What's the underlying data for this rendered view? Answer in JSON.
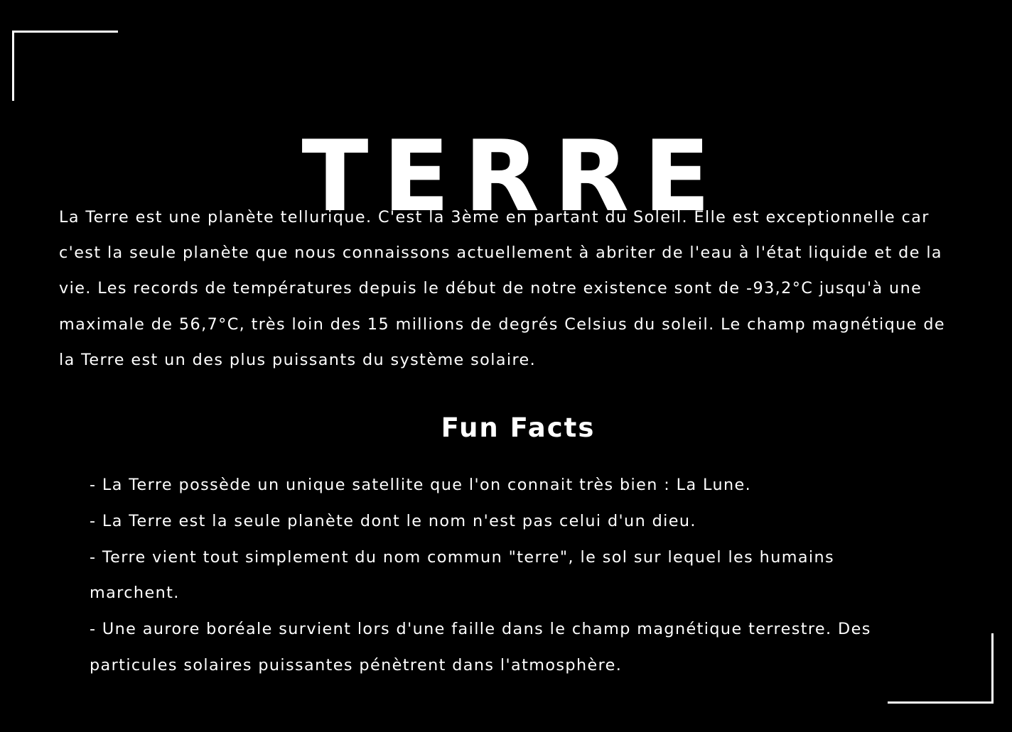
{
  "title": "TERRE",
  "intro": "La Terre est une planète tellurique. C'est la 3ème en partant du Soleil. Elle est exceptionnelle car c'est la seule planète que nous connaissons actuellement à abriter de l'eau à l'état liquide et de la vie. Les records de températures depuis le début de notre existence sont de -93,2°C jusqu'à une maximale de 56,7°C, très loin des 15 millions de degrés Celsius du soleil. Le champ magnétique de la Terre est un des plus puissants du système solaire.",
  "fun_facts": {
    "heading": "Fun Facts",
    "items": [
      "- La Terre possède un unique satellite que l'on connait très bien : La Lune.",
      "- La Terre est la seule planète dont le nom n'est pas celui d'un dieu.",
      "- Terre vient tout simplement du nom commun \"terre\", le sol sur lequel les humains marchent.",
      "- Une aurore boréale survient lors d'une faille dans le champ magnétique terrestre. Des particules solaires puissantes pénètrent dans l'atmosphère."
    ]
  },
  "colors": {
    "background": "#000000",
    "text": "#ffffff"
  }
}
